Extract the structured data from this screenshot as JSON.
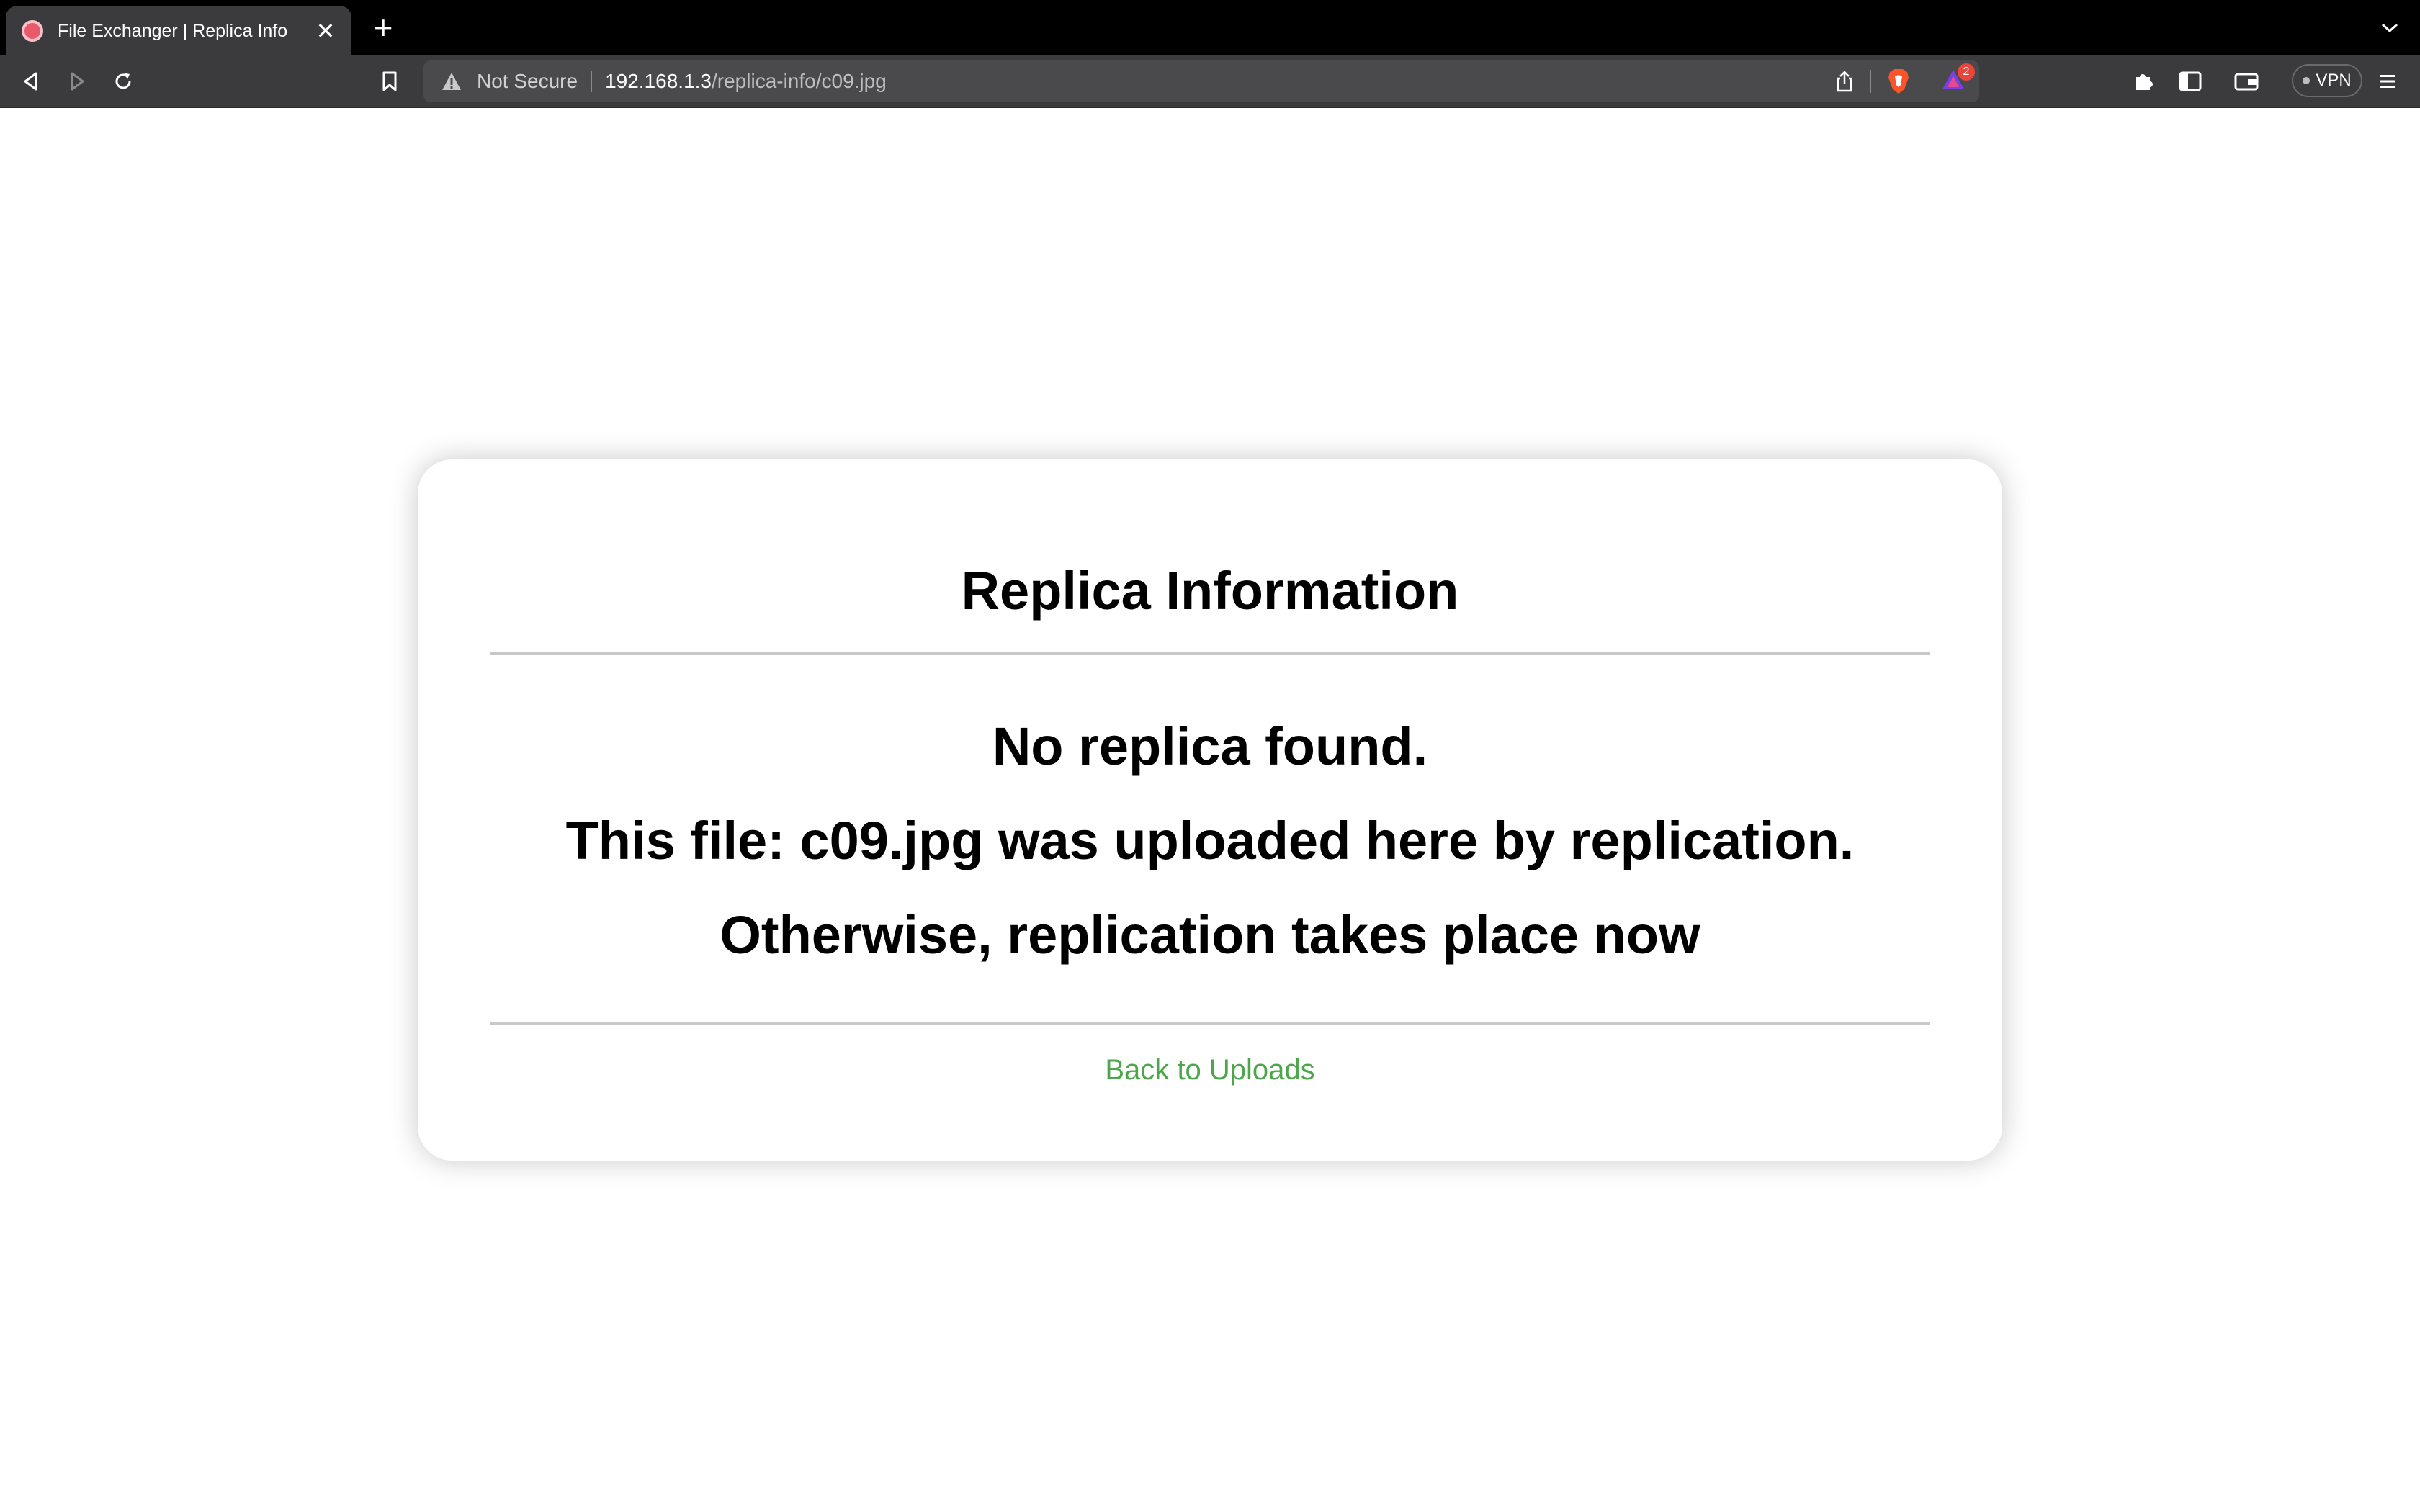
{
  "browser": {
    "tab": {
      "title": "File Exchanger | Replica Info",
      "close_glyph": "✕",
      "favicon": "brave-favicon-icon"
    },
    "new_tab_glyph": "+",
    "address_bar": {
      "security_label": "Not Secure",
      "url_host": "192.168.1.3",
      "url_path": "/replica-info/c09.jpg"
    },
    "shields_badge_count": "2",
    "vpn_label": "VPN",
    "colors": {
      "tabstrip": "#000000",
      "toolbar": "#3b3b3d",
      "omnibox": "#4a4a4c"
    }
  },
  "page": {
    "title": "Replica Information",
    "messages": [
      "No replica found.",
      "This file: c09.jpg was uploaded here by replication.",
      "Otherwise, replication takes place now"
    ],
    "back_link": "Back to Uploads",
    "colors": {
      "link": "#4ca64c",
      "divider": "#c8c8c8"
    }
  }
}
